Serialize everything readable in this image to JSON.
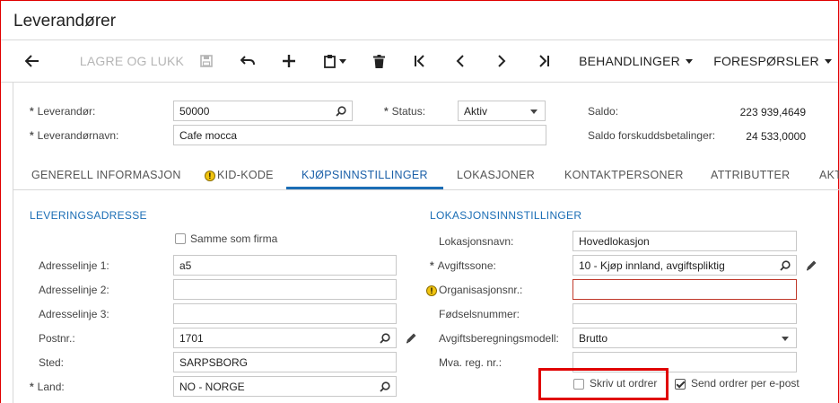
{
  "window": {
    "title": "Leverandører"
  },
  "toolbar": {
    "back_label": "",
    "save_close_label": "LAGRE OG LUKK",
    "behandlinger_label": "BEHANDLINGER",
    "foresporsler_label": "FORESPØRSLER"
  },
  "header": {
    "supplier_label": "Leverandør:",
    "supplier_value": "50000",
    "status_label": "Status:",
    "status_value": "Aktiv",
    "name_label": "Leverandørnavn:",
    "name_value": "Cafe mocca",
    "balance_label": "Saldo:",
    "balance_value": "223 939,4649",
    "prepay_label": "Saldo forskuddsbetalinger:",
    "prepay_value": "24 533,0000"
  },
  "tabs": [
    {
      "label": "GENERELL INFORMASJON"
    },
    {
      "label": "KID-KODE"
    },
    {
      "label": "KJØPSINNSTILLINGER"
    },
    {
      "label": "LOKASJONER"
    },
    {
      "label": "KONTAKTPERSONER"
    },
    {
      "label": "ATTRIBUTTER"
    },
    {
      "label": "AKT"
    }
  ],
  "delivery": {
    "section_title": "LEVERINGSADRESSE",
    "same_as_company_label": "Samme som firma",
    "address1_label": "Adresselinje 1:",
    "address1_value": "a5",
    "address2_label": "Adresselinje 2:",
    "address2_value": "",
    "address3_label": "Adresselinje 3:",
    "address3_value": "",
    "postal_label": "Postnr.:",
    "postal_value": "1701",
    "city_label": "Sted:",
    "city_value": "SARPSBORG",
    "country_label": "Land:",
    "country_value": "NO - NORGE"
  },
  "location": {
    "section_title": "LOKASJONSINNSTILLINGER",
    "location_name_label": "Lokasjonsnavn:",
    "location_name_value": "Hovedlokasjon",
    "tax_zone_label": "Avgiftssone:",
    "tax_zone_value": "10 - Kjøp innland, avgiftspliktig",
    "org_no_label": "Organisasjonsnr.:",
    "org_no_value": "",
    "birth_no_label": "Fødselsnummer:",
    "birth_no_value": "",
    "tax_model_label": "Avgiftsberegningsmodell:",
    "tax_model_value": "Brutto",
    "vat_no_label": "Mva. reg. nr.:",
    "vat_no_value": "",
    "print_orders_label": "Skriv ut ordrer",
    "email_orders_label": "Send ordrer per e-post"
  },
  "colors": {
    "accent": "#1a6db5",
    "highlight": "#e00000",
    "warning": "#f1c40f"
  }
}
